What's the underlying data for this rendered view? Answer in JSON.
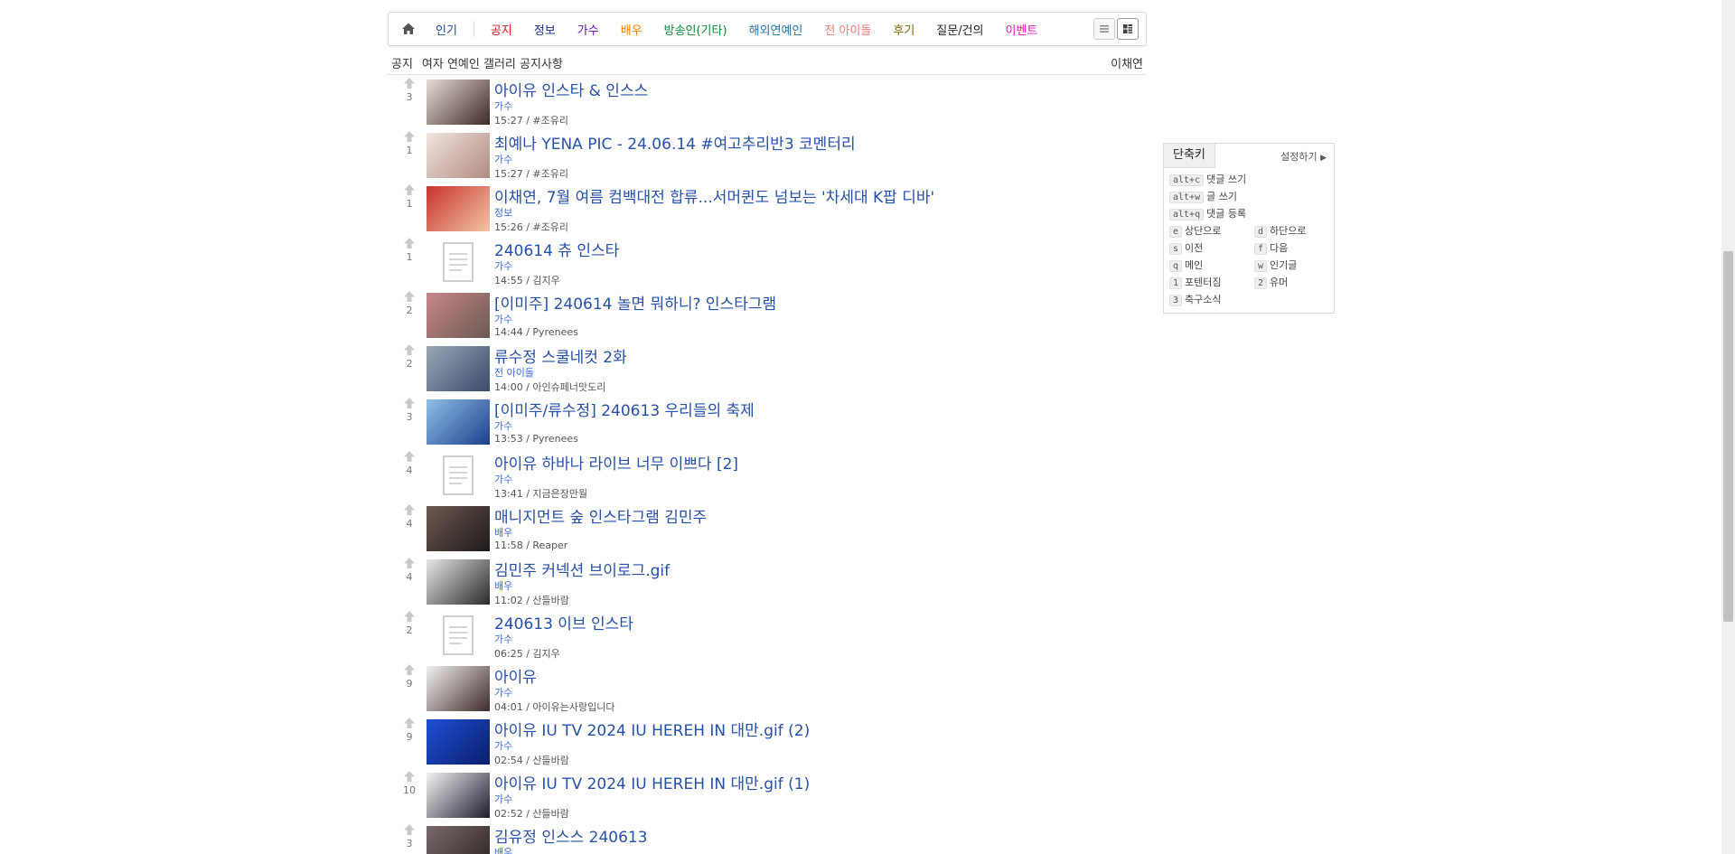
{
  "nav": {
    "home_icon": "home-icon",
    "categories": [
      {
        "label": "인기",
        "color": "#1e4aa0"
      },
      {
        "label": "공지",
        "color": "#e0191b"
      },
      {
        "label": "정보",
        "color": "#1a2d8f"
      },
      {
        "label": "가수",
        "color": "#6b16b0"
      },
      {
        "label": "배우",
        "color": "#ff7f00"
      },
      {
        "label": "방송인(기타)",
        "color": "#0c8a3a"
      },
      {
        "label": "해외연예인",
        "color": "#1f73a8"
      },
      {
        "label": "전 아이돌",
        "color": "#ef7c7c"
      },
      {
        "label": "후기",
        "color": "#7a6a0a"
      },
      {
        "label": "질문/건의",
        "color": "#222222"
      },
      {
        "label": "이벤트",
        "color": "#e619c7"
      }
    ],
    "view_icons": [
      "list-view-icon",
      "grid-view-icon"
    ]
  },
  "notice": {
    "label": "공지",
    "title": "여자 연예인 갤러리 공지사항",
    "author": "이채연"
  },
  "posts": [
    {
      "votes": "3",
      "title": "아이유 인스타 & 인스스",
      "category": "가수",
      "meta": "15:27 / #조유리",
      "thumb": "photo",
      "c1": "#e8dcd6",
      "c2": "#3b2a26"
    },
    {
      "votes": "1",
      "title": "최예나 YENA PIC - 24.06.14 #여고추리반3 코멘터리",
      "category": "가수",
      "meta": "15:27 / #조유리",
      "thumb": "photo",
      "c1": "#f1e5e0",
      "c2": "#b08a80"
    },
    {
      "votes": "1",
      "title": "이채연, 7월 여름 컴백대전 합류...서머퀸도 넘보는 '차세대 K팝 디바'",
      "category": "정보",
      "meta": "15:26 / #조유리",
      "thumb": "photo",
      "c1": "#c7322e",
      "c2": "#f3c4a5"
    },
    {
      "votes": "1",
      "title": "240614 츄 인스타",
      "category": "가수",
      "meta": "14:55 / 김지우",
      "thumb": "doc"
    },
    {
      "votes": "2",
      "title": "[이미주] 240614 놀면 뭐하니? 인스타그램",
      "category": "가수",
      "meta": "14:44 / Pyrenees",
      "thumb": "photo",
      "c1": "#c9868a",
      "c2": "#6a5a52"
    },
    {
      "votes": "2",
      "title": "류수정 스쿨네컷 2화",
      "category": "전 아이돌",
      "meta": "14:00 / 아인슈페너맛도리",
      "thumb": "photo",
      "c1": "#9aa6b6",
      "c2": "#3b4a6c"
    },
    {
      "votes": "3",
      "title": "[이미주/류수정] 240613 우리들의 축제",
      "category": "가수",
      "meta": "13:53 / Pyrenees",
      "thumb": "photo",
      "c1": "#8fbfe6",
      "c2": "#1d3f8c"
    },
    {
      "votes": "4",
      "title": "아이유 하바나 라이브 너무 이쁘다  [2]",
      "category": "가수",
      "meta": "13:41 / 지금은장만월",
      "thumb": "doc"
    },
    {
      "votes": "4",
      "title": "매니지먼트 숲 인스타그램 김민주",
      "category": "배우",
      "meta": "11:58 / Reaper",
      "thumb": "photo",
      "c1": "#6d5a52",
      "c2": "#1e1a1a"
    },
    {
      "votes": "4",
      "title": "김민주 커넥션 브이로그.gif",
      "category": "배우",
      "meta": "11:02 / 산들바람",
      "thumb": "photo",
      "c1": "#e6e6e6",
      "c2": "#2a2a2a"
    },
    {
      "votes": "2",
      "title": "240613 이브 인스타",
      "category": "가수",
      "meta": "06:25 / 김지우",
      "thumb": "doc"
    },
    {
      "votes": "9",
      "title": "아이유",
      "category": "가수",
      "meta": "04:01 / 아이유는사랑입니다",
      "thumb": "photo",
      "c1": "#f3f0ef",
      "c2": "#3c2b2a"
    },
    {
      "votes": "9",
      "title": "아이유 IU TV 2024 IU HEREH IN 대만.gif (2)",
      "category": "가수",
      "meta": "02:54 / 산들바람",
      "thumb": "photo",
      "c1": "#1e4fd6",
      "c2": "#0a1e6b"
    },
    {
      "votes": "10",
      "title": "아이유 IU TV 2024 IU HEREH IN 대만.gif (1)",
      "category": "가수",
      "meta": "02:52 / 산들바람",
      "thumb": "photo",
      "c1": "#f7f2f6",
      "c2": "#1c1c2c"
    },
    {
      "votes": "3",
      "title": "김유정 인스스 240613",
      "category": "배우",
      "meta": "",
      "thumb": "photo",
      "c1": "#7a6a6a",
      "c2": "#2a2222"
    }
  ],
  "shortcuts": {
    "title": "단축키",
    "settings_label": "설정하기",
    "items": [
      {
        "key": "alt+c",
        "label": "댓글 쓰기"
      },
      {
        "key": "alt+w",
        "label": "글 쓰기"
      },
      {
        "key": "alt+q",
        "label": "댓글 등록"
      },
      {
        "key": "e",
        "label": "상단으로"
      },
      {
        "key": "d",
        "label": "하단으로"
      },
      {
        "key": "s",
        "label": "이전"
      },
      {
        "key": "f",
        "label": "다음"
      },
      {
        "key": "q",
        "label": "메인"
      },
      {
        "key": "w",
        "label": "인기글"
      },
      {
        "key": "1",
        "label": "포텐터짐"
      },
      {
        "key": "2",
        "label": "유머"
      },
      {
        "key": "3",
        "label": "축구소식"
      }
    ]
  }
}
